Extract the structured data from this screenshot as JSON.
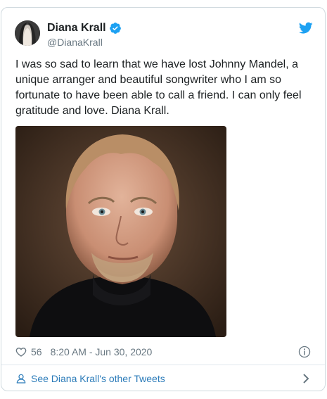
{
  "author": {
    "display_name": "Diana Krall",
    "handle": "@DianaKrall"
  },
  "tweet": {
    "text": "I was so sad to learn that we have lost Johnny Mandel, a unique arranger and beautiful songwriter who I am so fortunate to have been able to call a friend. I can only feel gratitude and love. Diana Krall."
  },
  "meta": {
    "like_count": "56",
    "timestamp": "8:20 AM - Jun 30, 2020"
  },
  "footer": {
    "link_label": "See Diana Krall's other Tweets"
  },
  "icons": {
    "twitter": "twitter-bird-icon",
    "verified": "verified-badge-icon",
    "like": "heart-icon",
    "info": "info-icon",
    "person": "person-icon",
    "chevron": "chevron-right-icon"
  },
  "colors": {
    "twitter_blue": "#1da1f2",
    "link_blue": "#2b7bb9",
    "meta_gray": "#697882",
    "border": "#cfd9de"
  }
}
